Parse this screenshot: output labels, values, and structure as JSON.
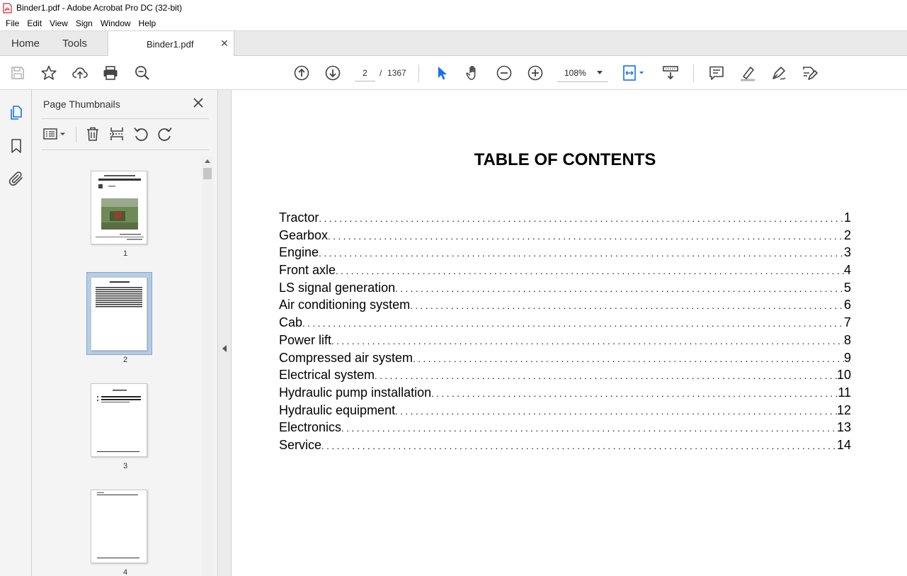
{
  "window": {
    "title": "Binder1.pdf - Adobe Acrobat Pro DC (32-bit)"
  },
  "menu": [
    "File",
    "Edit",
    "View",
    "Sign",
    "Window",
    "Help"
  ],
  "tabs": {
    "home": "Home",
    "tools": "Tools",
    "document": "Binder1.pdf"
  },
  "toolbar": {
    "current_page": "2",
    "separator": "/",
    "total_pages": "1367",
    "zoom": "108%"
  },
  "panel": {
    "title": "Page Thumbnails",
    "thumbnails": [
      {
        "label": "1",
        "selected": false
      },
      {
        "label": "2",
        "selected": true
      },
      {
        "label": "3",
        "selected": false
      },
      {
        "label": "4",
        "selected": false
      }
    ]
  },
  "document": {
    "heading": "TABLE OF CONTENTS",
    "entries": [
      {
        "title": "Tractor",
        "page": "1"
      },
      {
        "title": "Gearbox",
        "page": "2"
      },
      {
        "title": "Engine",
        "page": "3"
      },
      {
        "title": "Front axle",
        "page": "4"
      },
      {
        "title": "LS signal generation",
        "page": "5"
      },
      {
        "title": "Air conditioning system",
        "page": "6"
      },
      {
        "title": "Cab",
        "page": "7"
      },
      {
        "title": "Power lift",
        "page": "8"
      },
      {
        "title": "Compressed air system",
        "page": "9"
      },
      {
        "title": "Electrical system",
        "page": "10"
      },
      {
        "title": "Hydraulic pump installation",
        "page": "11"
      },
      {
        "title": "Hydraulic equipment",
        "page": "12"
      },
      {
        "title": "Electronics",
        "page": "13"
      },
      {
        "title": "Service",
        "page": "14"
      }
    ]
  },
  "colors": {
    "accent": "#1473e6",
    "selection": "#b6cde6",
    "pdf_red": "#d7282f"
  }
}
